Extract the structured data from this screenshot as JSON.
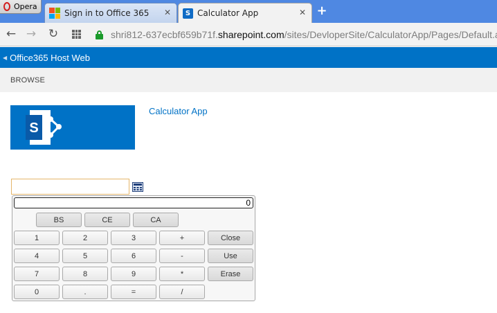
{
  "browser": {
    "opera_label": "Opera",
    "tabs": [
      {
        "title": "Sign in to Office 365",
        "active": false
      },
      {
        "title": "Calculator App",
        "active": true
      }
    ],
    "new_tab_label": "+",
    "url": {
      "prefix": "shri812-637ecbf659b71f.",
      "domain": "sharepoint.com",
      "path": "/sites/DevloperSite/CalculatorApp/Pages/Default.aspx"
    }
  },
  "sharepoint": {
    "host_web_link": "Office365 Host Web",
    "ribbon_tab": "BROWSE",
    "logo_letter": "S",
    "site_title": "Calculator App"
  },
  "calculator": {
    "input_value": "",
    "display_value": "0",
    "top_buttons": [
      "BS",
      "CE",
      "CA"
    ],
    "rows": [
      [
        "1",
        "2",
        "3",
        "+",
        "Close"
      ],
      [
        "4",
        "5",
        "6",
        "-",
        "Use"
      ],
      [
        "7",
        "8",
        "9",
        "*",
        "Erase"
      ],
      [
        "0",
        ".",
        "=",
        "/"
      ]
    ]
  },
  "colors": {
    "suite_bar": "#0072c6",
    "tab_strip": "#4f88e2",
    "site_title": "#0072c6",
    "input_border": "#e5b66a"
  }
}
